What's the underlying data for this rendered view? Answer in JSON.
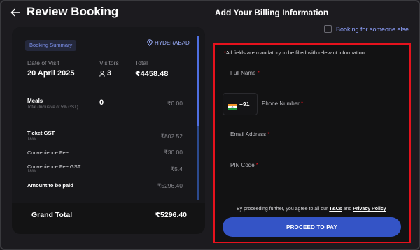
{
  "header": {
    "back_icon": "arrow-left-icon",
    "title": "Review Booking"
  },
  "summary": {
    "chip_label": "Booking Summary",
    "location_icon": "map-pin-icon",
    "location": "HYDERABAD",
    "date_label": "Date of Visit",
    "date_value": "20 April 2025",
    "visitors_label": "Visitors",
    "visitors_icon": "user-icon",
    "visitors_value": "3",
    "total_label": "Total",
    "total_value": "₹4458.48",
    "meals_label": "Meals",
    "meals_sub": "Total (Inclusive of 5% GST)",
    "meals_count": "0",
    "meals_amount": "₹0.00",
    "ticket_gst_label": "Ticket GST",
    "ticket_gst_rate": "18%",
    "ticket_gst_amount": "₹802.52",
    "convenience_fee_label": "Convenience Fee",
    "convenience_fee_amount": "₹30.00",
    "convenience_gst_label": "Convenience Fee GST",
    "convenience_gst_rate": "18%",
    "convenience_gst_amount": "₹5.4",
    "amount_to_pay_label": "Amount to be paid",
    "amount_to_pay_value": "₹5296.40",
    "grand_total_label": "Grand Total",
    "grand_total_value": "₹5296.40"
  },
  "billing": {
    "title": "Add Your Billing Information",
    "someone_else_label": "Booking for someone else",
    "mandatory_note": "All fields are mandatory to be filled with relevant information.",
    "required_mark": "*",
    "full_name_placeholder": "Full Name",
    "phone_prefix": "+91",
    "phone_placeholder": "Phone Number",
    "email_placeholder": "Email Address",
    "pin_placeholder": "PIN Code",
    "terms_prefix": "By proceeding further, you agree to all our",
    "terms_link": "T&Cs",
    "terms_and": "and",
    "privacy_link": "Privacy Policy",
    "pay_button": "PROCEED TO PAY"
  },
  "colors": {
    "background": "#1c1b1f",
    "accent": "#3454c6",
    "highlight_border": "#e5121d",
    "link_blue": "#8fa2ff"
  }
}
